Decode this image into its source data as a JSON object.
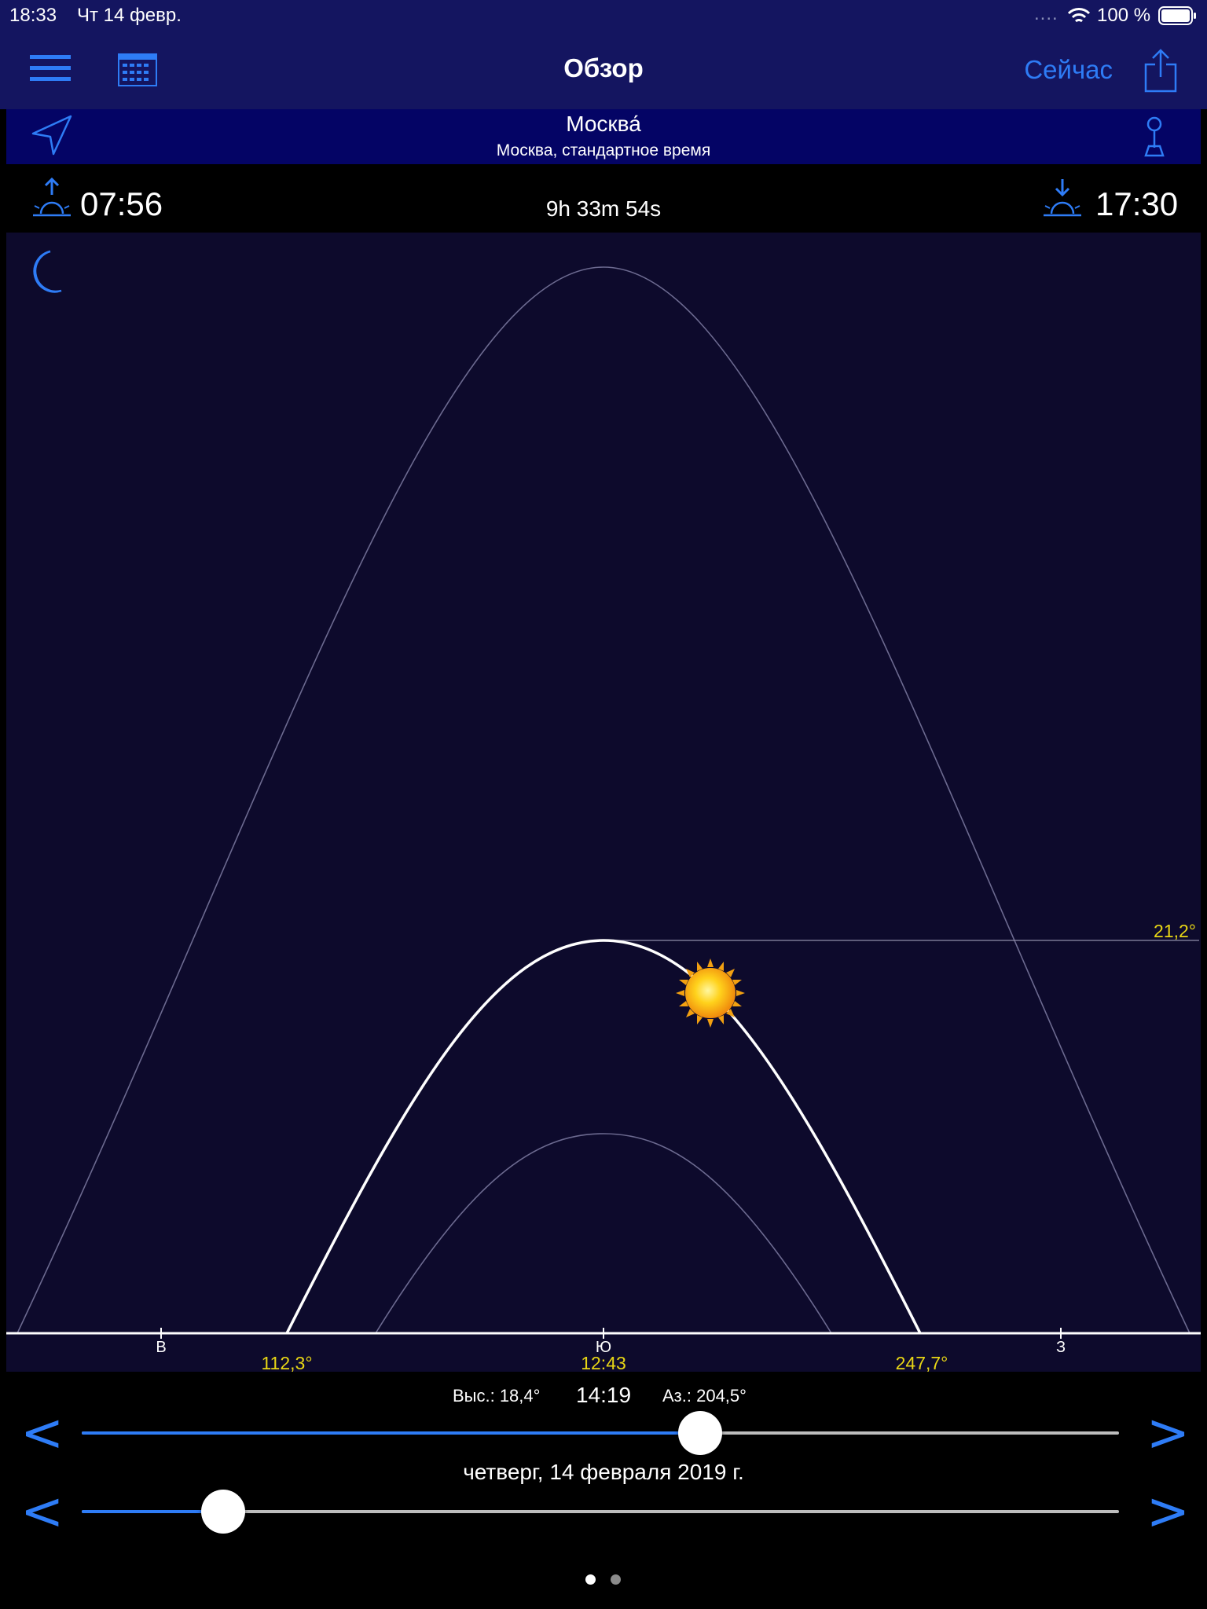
{
  "status_bar": {
    "time": "18:33",
    "date": "Чт 14 февр.",
    "battery": "100 %",
    "dots": "....",
    "icons": [
      "wifi-icon",
      "battery-icon"
    ]
  },
  "nav": {
    "title": "Обзор",
    "now_label": "Сейчас",
    "icons": [
      "menu-icon",
      "calendar-icon",
      "share-icon"
    ]
  },
  "location": {
    "name": "Москва́",
    "timezone": "Москва, стандартное время",
    "icons": [
      "location-arrow-icon",
      "map-pin-icon"
    ]
  },
  "sun_times": {
    "sunrise": "07:56",
    "day_length": "9h 33m 54s",
    "sunset": "17:30",
    "icons": [
      "sunrise-icon",
      "sunset-icon",
      "moon-icon"
    ]
  },
  "chart_data": {
    "type": "line",
    "direction_labels": [
      "В",
      "Ю",
      "З"
    ],
    "max_altitude_label": "21,2°",
    "sunrise_azimuth": "112,3°",
    "noon_time": "12:43",
    "sunset_azimuth": "247,7°",
    "current_position": {
      "altitude": 18.4,
      "azimuth": 204.5
    },
    "series": [
      {
        "role": "summer-solstice-path",
        "max_altitude": 57.9
      },
      {
        "role": "today-path",
        "max_altitude": 21.2,
        "rise_azimuth": 112.3,
        "set_azimuth": 247.7
      },
      {
        "role": "winter-solstice-path",
        "max_altitude": 11
      }
    ]
  },
  "readout": {
    "altitude": "Выс.: 18,4°",
    "time": "14:19",
    "azimuth": "Аз.: 204,5°"
  },
  "sliders": {
    "time_fraction": 0.596,
    "date_fraction": 0.136,
    "date_label": "четверг, 14 февраля 2019 г.",
    "prev": "<",
    "next": ">"
  },
  "colors": {
    "accent": "#2e7cf6",
    "nav_bg": "#141560",
    "location_bg": "#040465",
    "chart_bg": "#0d0a2c",
    "label_yellow": "#e8d615"
  },
  "page_indicator": {
    "pages": 2,
    "active": 0
  }
}
